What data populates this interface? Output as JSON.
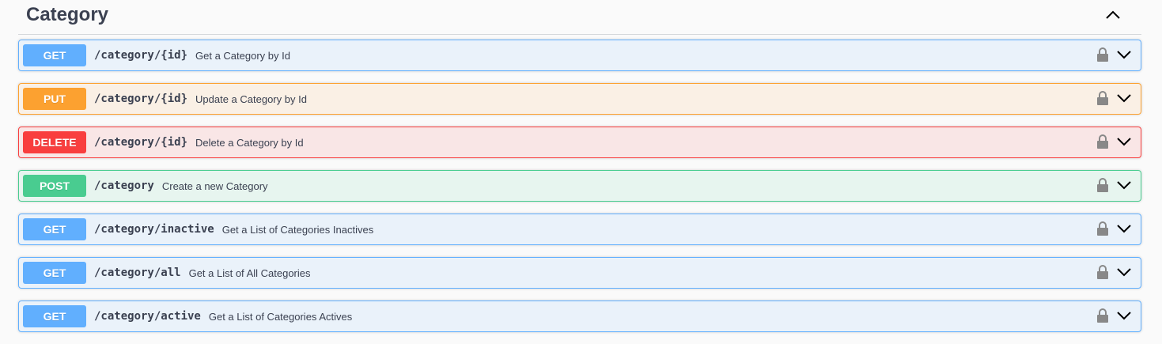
{
  "section": {
    "title": "Category",
    "collapse_icon": "chevron-up-icon"
  },
  "colors": {
    "get": "#61affe",
    "put": "#fca130",
    "delete": "#f93e3e",
    "post": "#49cc90"
  },
  "operations": [
    {
      "method": "GET",
      "path": "/category/{id}",
      "summary": "Get a Category by Id"
    },
    {
      "method": "PUT",
      "path": "/category/{id}",
      "summary": "Update a Category by Id"
    },
    {
      "method": "DELETE",
      "path": "/category/{id}",
      "summary": "Delete a Category by Id"
    },
    {
      "method": "POST",
      "path": "/category",
      "summary": "Create a new Category"
    },
    {
      "method": "GET",
      "path": "/category/inactive",
      "summary": "Get a List of Categories Inactives"
    },
    {
      "method": "GET",
      "path": "/category/all",
      "summary": "Get a List of All Categories"
    },
    {
      "method": "GET",
      "path": "/category/active",
      "summary": "Get a List of Categories Actives"
    }
  ],
  "icons": {
    "lock": "lock-icon",
    "expand": "chevron-down-icon"
  }
}
